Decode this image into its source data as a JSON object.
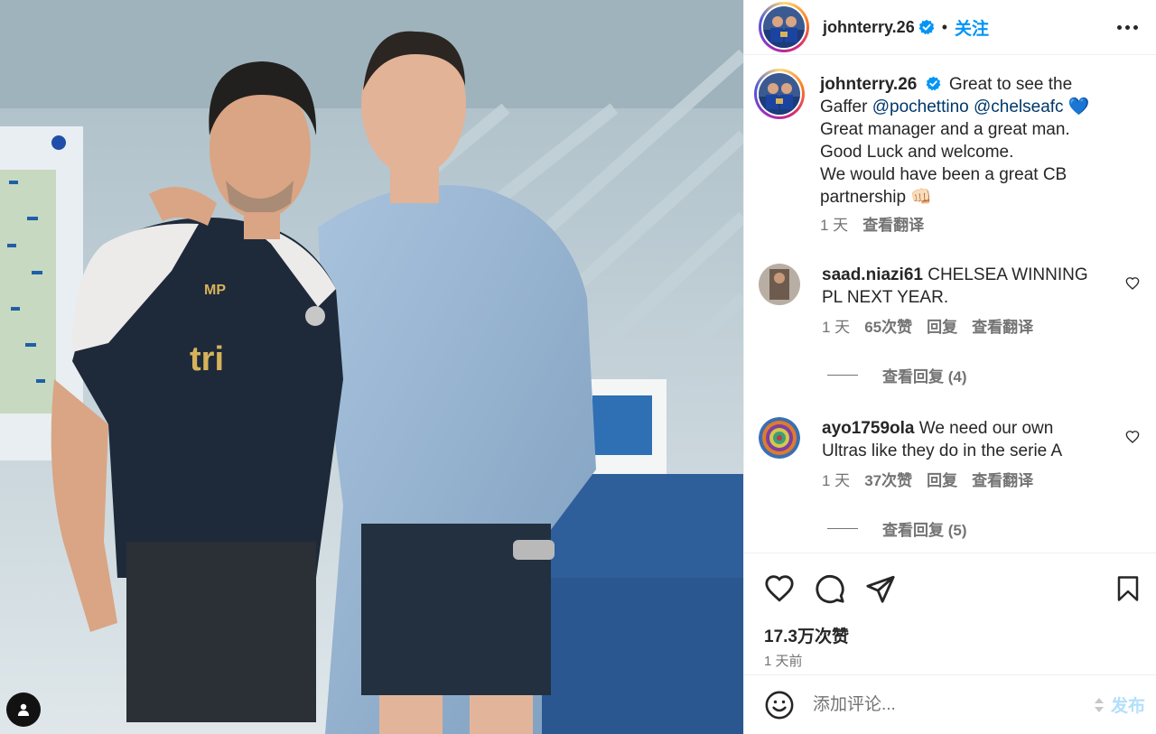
{
  "post": {
    "username": "johnterry.26",
    "follow_label": "关注",
    "separator": "•",
    "caption_lead": "Great to see the Gaffer",
    "caption_mention_1": "@pochettino",
    "caption_mention_2": "@chelseafc",
    "caption_heart": "💙",
    "caption_line_2": "Great manager and a great man.",
    "caption_line_3": "Good Luck and welcome.",
    "caption_line_4": "We would have been a great CB partnership",
    "caption_emoji": "👊🏻",
    "caption_time": "1 天",
    "caption_translate": "查看翻译",
    "photo_shirt_text": "tri",
    "photo_shirt_initials": "MP"
  },
  "comments": [
    {
      "username": "saad.niazi61",
      "text": "CHELSEA WINNING PL NEXT YEAR.",
      "time": "1 天",
      "likes": "65次赞",
      "reply": "回复",
      "translate": "查看翻译",
      "view_replies": "查看回复 (4)"
    },
    {
      "username": "ayo1759ola",
      "text": "We need our own Ultras like they do in the serie A",
      "time": "1 天",
      "likes": "37次赞",
      "reply": "回复",
      "translate": "查看翻译",
      "view_replies": "查看回复 (5)"
    }
  ],
  "footer": {
    "like_count": "17.3万次赞",
    "post_date": "1 天前",
    "comment_placeholder": "添加评论...",
    "post_label": "发布"
  },
  "icons": {
    "like": "heart-icon",
    "comment": "comment-icon",
    "share": "share-icon",
    "save": "bookmark-icon",
    "emoji": "emoji-icon",
    "more": "more-options-icon",
    "verified": "verified-badge-icon",
    "tags": "user-tag-icon"
  },
  "colors": {
    "accent": "#0095f6",
    "verified": "#0095f6",
    "post_disabled": "#b2dffc",
    "muted": "#737373"
  }
}
